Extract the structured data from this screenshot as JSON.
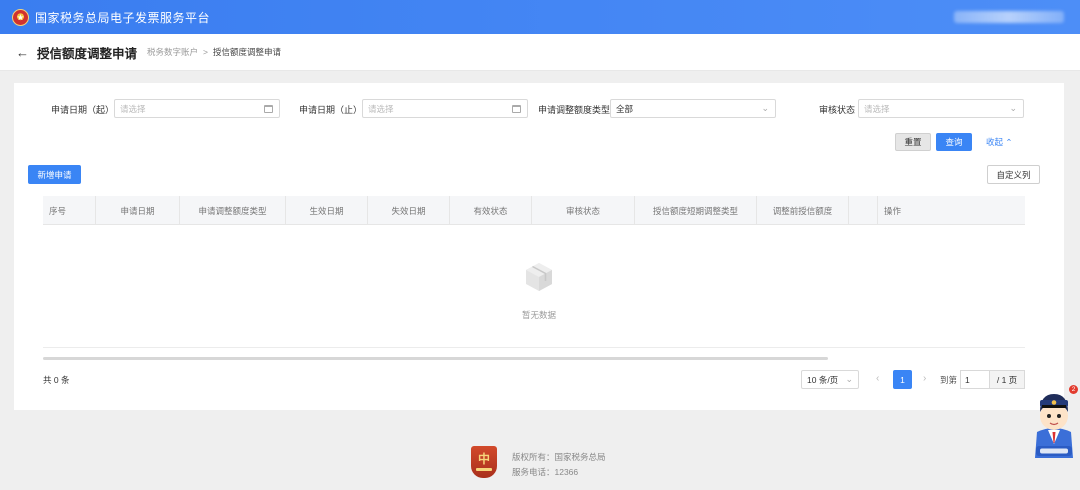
{
  "header": {
    "title": "国家税务总局电子发票服务平台",
    "emblem_glyph": "★"
  },
  "breadcrumb": {
    "back_glyph": "←",
    "title": "授信额度调整申请",
    "parent": "税务数字账户",
    "separator": ">",
    "current": "授信额度调整申请"
  },
  "filters": {
    "apply_date_start": {
      "label": "申请日期（起）",
      "placeholder": "请选择"
    },
    "apply_date_end": {
      "label": "申请日期（止）",
      "placeholder": "请选择"
    },
    "adjust_type": {
      "label": "申请调整额度类型",
      "value": "全部"
    },
    "review_status": {
      "label": "审核状态",
      "placeholder": "请选择"
    },
    "chevron_glyph": "⌄"
  },
  "actions": {
    "reset": "重置",
    "query": "查询",
    "collapse": "收起 ⌃",
    "new_apply": "新增申请",
    "custom_columns": "自定义列"
  },
  "table": {
    "columns": [
      "序号",
      "申请日期",
      "申请调整额度类型",
      "生效日期",
      "失效日期",
      "有效状态",
      "审核状态",
      "授信额度短期调整类型",
      "调整前授信额度",
      "",
      "操作"
    ],
    "empty_text": "暂无数据"
  },
  "pagination": {
    "total_text": "共 0 条",
    "page_size": "10 条/页",
    "prev_glyph": "‹",
    "current_page": "1",
    "next_glyph": "›",
    "goto_label": "到第",
    "goto_value": "1",
    "total_pages": "/ 1 页"
  },
  "footer": {
    "logo_glyph": "中",
    "copyright": "版权所有：国家税务总局",
    "service_tel": "服务电话：12366"
  },
  "assistant": {
    "badge_count": "2"
  },
  "colors": {
    "primary": "#3a85f5",
    "header": "#3a7df0"
  }
}
